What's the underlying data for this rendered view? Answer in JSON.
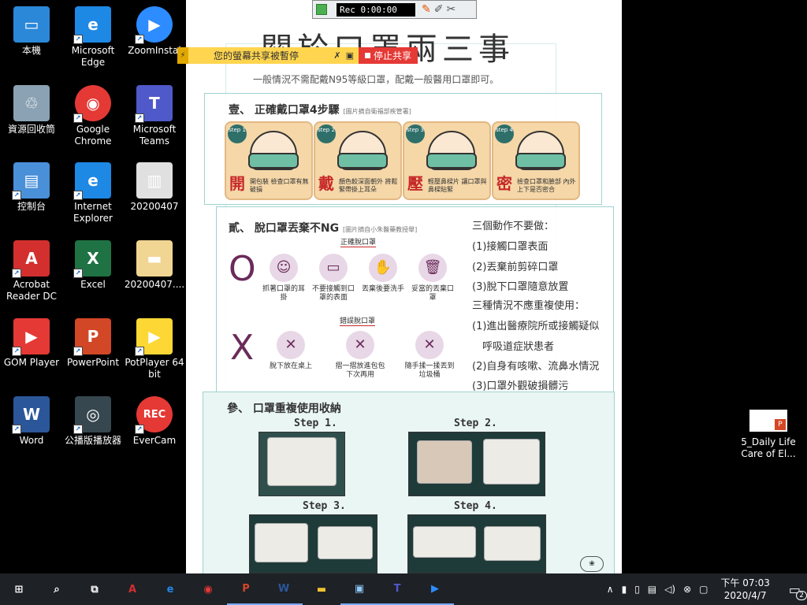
{
  "desktop": {
    "icons": [
      {
        "label": "本機",
        "icon": "pc-icon",
        "color": "#2b88d8"
      },
      {
        "label": "Microsoft Edge",
        "icon": "edge-icon",
        "color": "#1e88e5"
      },
      {
        "label": "ZoomInstal",
        "icon": "zoom-icon",
        "color": "#2d8cff"
      },
      {
        "label": "資源回收筒",
        "icon": "recycle-bin-icon",
        "color": "#8aa2b3"
      },
      {
        "label": "Google Chrome",
        "icon": "chrome-icon",
        "color": "#e53935"
      },
      {
        "label": "Microsoft Teams",
        "icon": "teams-icon",
        "color": "#5059c9"
      },
      {
        "label": "控制台",
        "icon": "control-panel-icon",
        "color": "#4a90d9"
      },
      {
        "label": "Internet Explorer",
        "icon": "ie-icon",
        "color": "#1e88e5"
      },
      {
        "label": "20200407",
        "icon": "document-icon",
        "color": "#e0e0e0"
      },
      {
        "label": "Acrobat Reader DC",
        "icon": "acrobat-icon",
        "color": "#d32f2f"
      },
      {
        "label": "Excel",
        "icon": "excel-icon",
        "color": "#1f7244"
      },
      {
        "label": "20200407....",
        "icon": "folder-icon",
        "color": "#f1d592"
      },
      {
        "label": "GOM Player",
        "icon": "gom-player-icon",
        "color": "#e53935"
      },
      {
        "label": "PowerPoint",
        "icon": "powerpoint-icon",
        "color": "#d24726"
      },
      {
        "label": "PotPlayer 64 bit",
        "icon": "potplayer-icon",
        "color": "#fdd835"
      },
      {
        "label": "Word",
        "icon": "word-icon",
        "color": "#2b579a"
      },
      {
        "label": "公播版播放器",
        "icon": "player-icon",
        "color": "#37474f"
      },
      {
        "label": "EverCam",
        "icon": "evercam-icon",
        "color": "#e53935"
      }
    ],
    "right_icon": {
      "label": "5_Daily Life Care of El...",
      "icon": "powerpoint-file-icon"
    }
  },
  "recorder": {
    "status": "Rec 0:00:00"
  },
  "share_bar": {
    "message": "您的螢幕共享被暫停",
    "stop_label": "停止共享"
  },
  "poster": {
    "title": "關於口罩兩三事",
    "subtitle": "一般情況不需配戴N95等級口罩，配戴一般醫用口罩即可。",
    "section1": {
      "heading": "壹、 正確戴口罩4步驟",
      "note": "[圖片摘自衛福部疾管署]",
      "steps": [
        {
          "step": "step 1",
          "big": "開",
          "text": "開包裝 檢查口罩有無破損"
        },
        {
          "step": "step 2",
          "big": "戴",
          "text": "顏色較深面朝外 將鬆緊帶掛上耳朵"
        },
        {
          "step": "step 3",
          "big": "壓",
          "text": "輕壓鼻樑片 讓口罩與鼻樑貼緊"
        },
        {
          "step": "step 4",
          "big": "密",
          "text": "檢查口罩和臉部 內外上下是否密合"
        }
      ]
    },
    "section2": {
      "heading": "貳、 脫口罩丟棄不NG",
      "note": "[圖片摘自小朱醫藥教授舉]",
      "correct_label": "正確脫口罩",
      "wrong_label": "錯誤脫口罩",
      "correct_items": [
        "抓著口罩的耳掛",
        "不要接觸到口罩的表面",
        "丟棄後要洗手",
        "妥當的丟棄口罩"
      ],
      "wrong_items": [
        "脫下放在桌上",
        "摺一摺放進包包下次再用",
        "隨手揉一揉丟到垃圾桶"
      ],
      "rules": [
        "三個動作不要做：",
        "(1)接觸口罩表面",
        "(2)丟棄前剪碎口罩",
        "(3)脫下口罩隨意放置",
        "三種情況不應重複使用：",
        "(1)進出醫療院所或接觸疑似",
        "呼吸道症狀患者",
        "(2)自身有咳嗽、流鼻水情況",
        "(3)口罩外觀破損髒污"
      ]
    },
    "section3": {
      "heading": "參、 口罩重複使用收納",
      "steps": [
        "Step 1.",
        "Step 2.",
        "Step 3.",
        "Step 4."
      ]
    }
  },
  "taskbar": {
    "apps": [
      "start-icon",
      "search-icon",
      "task-view-icon",
      "acrobat-icon",
      "edge-icon",
      "chrome-icon",
      "powerpoint-icon",
      "word-icon",
      "file-explorer-icon",
      "network-icon",
      "teams-icon",
      "zoom-icon"
    ],
    "time": "下午 07:03",
    "date": "2020/4/7",
    "notifications": "2"
  }
}
